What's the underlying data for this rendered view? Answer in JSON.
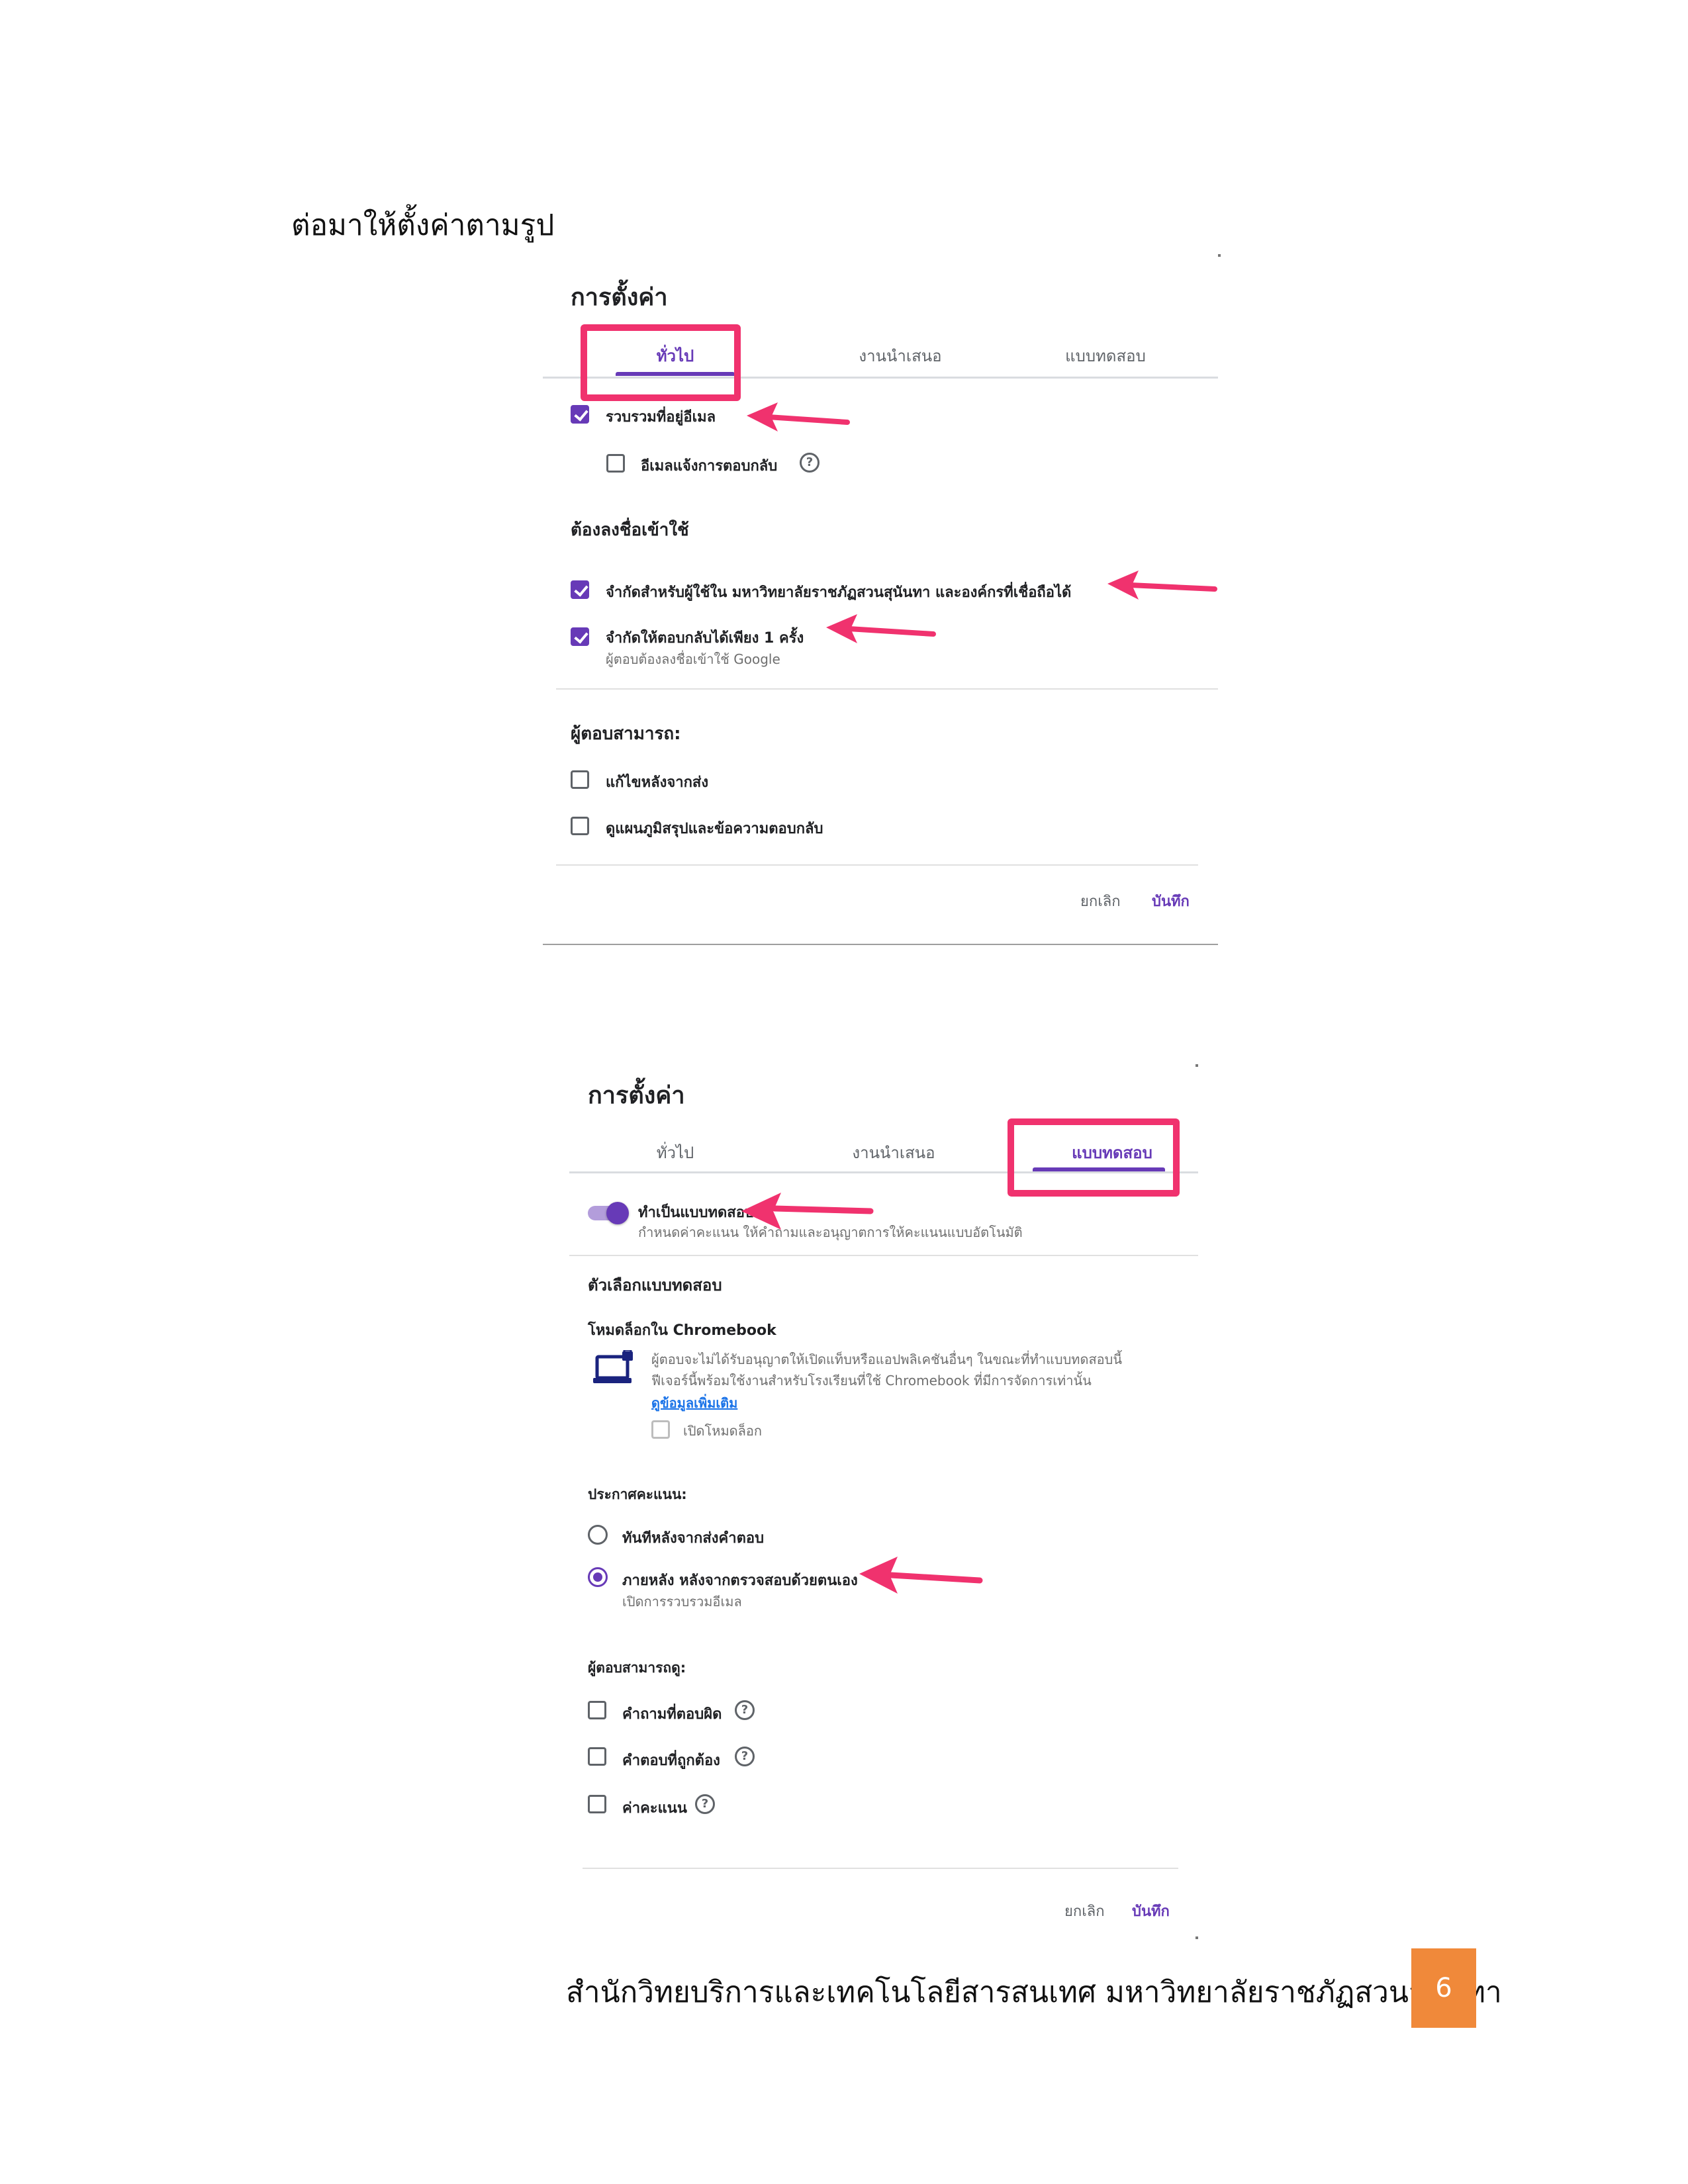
{
  "intro_text": "ต่อมาให้ตั้งค่าตามรูป",
  "panel1": {
    "title": "การตั้งค่า",
    "tabs": [
      "ทั่วไป",
      "งานนำเสนอ",
      "แบบทดสอบ"
    ],
    "active_tab": "ทั่วไป",
    "collect_email": "รวบรวมที่อยู่อีเมล",
    "email_receipt": "อีเมลแจ้งการตอบกลับ",
    "signin_heading": "ต้องลงชื่อเข้าใช้",
    "restrict_users": "จำกัดสำหรับผู้ใช้ใน มหาวิทยาลัยราชภัฏสวนสุนันทา และองค์กรที่เชื่อถือได้",
    "limit_one": "จำกัดให้ตอบกลับได้เพียง 1 ครั้ง",
    "limit_one_sub": "ผู้ตอบต้องลงชื่อเข้าใช้ Google",
    "respondents_heading": "ผู้ตอบสามารถ:",
    "edit_after": "แก้ไขหลังจากส่ง",
    "see_summary": "ดูแผนภูมิสรุปและข้อความตอบกลับ",
    "cancel": "ยกเลิก",
    "save": "บันทึก",
    "states": {
      "collect_email": true,
      "email_receipt": false,
      "restrict_users": true,
      "limit_one": true,
      "edit_after": false,
      "see_summary": false
    }
  },
  "panel2": {
    "title": "การตั้งค่า",
    "tabs": [
      "ทั่วไป",
      "งานนำเสนอ",
      "แบบทดสอบ"
    ],
    "active_tab": "แบบทดสอบ",
    "make_quiz": "ทำเป็นแบบทดสอบ",
    "make_quiz_sub": "กำหนดค่าคะแนน ให้คำถามและอนุญาตการให้คะแนนแบบอัตโนมัติ",
    "make_quiz_on": true,
    "quiz_options_heading": "ตัวเลือกแบบทดสอบ",
    "locked_mode_title": "โหมดล็อกใน Chromebook",
    "locked_mode_desc_1": "ผู้ตอบจะไม่ได้รับอนุญาตให้เปิดแท็บหรือแอปพลิเคชันอื่นๆ ในขณะที่ทำแบบทดสอบนี้",
    "locked_mode_desc_2": "ฟีเจอร์นี้พร้อมใช้งานสำหรับโรงเรียนที่ใช้ Chromebook ที่มีการจัดการเท่านั้น",
    "learn_more": "ดูข้อมูลเพิ่มเติม",
    "enable_locked": "เปิดโหมดล็อก",
    "release_heading": "ประกาศคะแนน:",
    "release_immediate": "ทันทีหลังจากส่งคำตอบ",
    "release_later": "ภายหลัง หลังจากตรวจสอบด้วยตนเอง",
    "release_later_sub": "เปิดการรวบรวมอีเมล",
    "release_selected": "ภายหลัง หลังจากตรวจสอบด้วยตนเอง",
    "can_see_heading": "ผู้ตอบสามารถดู:",
    "missed_questions": "คำถามที่ตอบผิด",
    "correct_answers": "คำตอบที่ถูกต้อง",
    "point_values": "ค่าคะแนน",
    "cancel": "ยกเลิก",
    "save": "บันทึก"
  },
  "footer": {
    "text": "สำนักวิทยบริการและเทคโนโลยีสารสนเทศ มหาวิทยาลัยราชภัฏสวนสุนันทา",
    "page_number": "6"
  },
  "colors": {
    "accent": "#673ab7",
    "highlight": "#f0326e",
    "page_badge": "#f0893a"
  }
}
